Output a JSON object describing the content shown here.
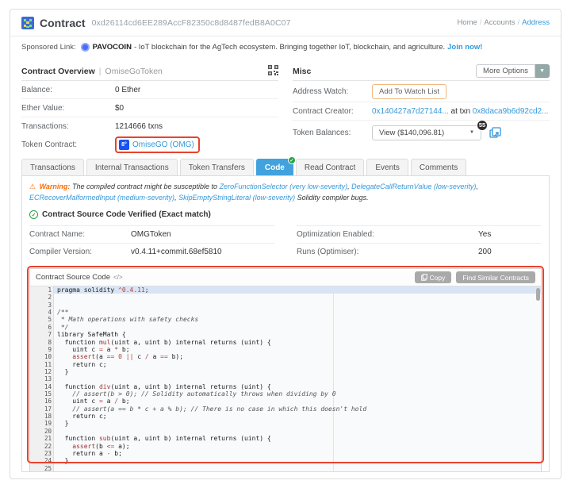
{
  "colors": {
    "accent_blue": "#3498db",
    "tab_active_blue": "#41a2dd",
    "annotation_red": "#e8432d",
    "warning_orange": "#ff6a00",
    "verified_green": "#2f9e44",
    "badge_green": "#28a745"
  },
  "header": {
    "title": "Contract",
    "address": "0xd26114cd6EE289AccF82350c8d8487fedB8A0C07",
    "breadcrumb": {
      "home": "Home",
      "accounts": "Accounts",
      "address": "Address",
      "separator": "/"
    }
  },
  "sponsored": {
    "label": "Sponsored Link:",
    "name": "PAVOCOIN",
    "text": "- IoT blockchain for the AgTech ecosystem. Bringing together IoT, blockchain, and agriculture.",
    "cta": "Join now!"
  },
  "overview": {
    "title": "Contract Overview",
    "divider": "|",
    "subtitle": "OmiseGoToken",
    "rows": [
      {
        "label": "Balance:",
        "value": "0 Ether"
      },
      {
        "label": "Ether Value:",
        "value": "$0"
      },
      {
        "label": "Transactions:",
        "value": "1214666 txns"
      }
    ],
    "token_label": "Token Contract:",
    "token_symbol": "8°",
    "token_link": "OmiseGO (OMG)"
  },
  "misc": {
    "title": "Misc",
    "more_options_label": "More Options",
    "more_options_caret": "▼",
    "address_watch_label": "Address Watch:",
    "watch_button_label": "Add To Watch List",
    "creator_label": "Contract Creator:",
    "creator_address": "0x140427a7d27144...",
    "creator_mid": "at txn",
    "creator_txn": "0x8daca9b6d92cd2...",
    "balances_label": "Token Balances:",
    "balances_value": "View ($140,096.81)",
    "balances_caret": "▼",
    "balances_badge": "55"
  },
  "tabs": [
    {
      "label": "Transactions",
      "active": false
    },
    {
      "label": "Internal Transactions",
      "active": false
    },
    {
      "label": "Token Transfers",
      "active": false
    },
    {
      "label": "Code",
      "active": true,
      "badge": "✓"
    },
    {
      "label": "Read Contract",
      "active": false
    },
    {
      "label": "Events",
      "active": false
    },
    {
      "label": "Comments",
      "active": false
    }
  ],
  "warning": {
    "triangle": "⚠",
    "prefix": "Warning:",
    "segments": [
      {
        "t": "The compiled contract might be susceptible to "
      },
      {
        "t": "ZeroFunctionSelector (very low-severity)",
        "link": true
      },
      {
        "t": ", "
      },
      {
        "t": "DelegateCallReturnValue (low-severity)",
        "link": true
      },
      {
        "t": ", "
      },
      {
        "t": "ECRecoverMalformedInput (medium-severity)",
        "link": true
      },
      {
        "t": ", "
      },
      {
        "t": "SkipEmptyStringLiteral (low-severity)",
        "link": true
      },
      {
        "t": " Solidity compiler bugs."
      }
    ]
  },
  "verified": {
    "check": "✓",
    "text": "Contract Source Code Verified (Exact match)"
  },
  "details": {
    "cells": [
      {
        "label": "Contract Name:",
        "value": "OMGToken",
        "side": "left"
      },
      {
        "label": "Optimization Enabled:",
        "value": "Yes",
        "side": "right"
      },
      {
        "label": "Compiler Version:",
        "value": "v0.4.11+commit.68ef5810",
        "side": "left"
      },
      {
        "label": "Runs (Optimiser):",
        "value": "200",
        "side": "right"
      }
    ]
  },
  "source": {
    "title": "Contract Source Code",
    "title_glyph": "</>",
    "copy_label": "Copy",
    "find_label": "Find Similar Contracts",
    "active_line": 1,
    "fold_lines": [
      4,
      7,
      8,
      14,
      21
    ],
    "lines": [
      [
        [
          "p",
          "pragma solidity "
        ],
        [
          "n",
          "^0.4.11"
        ],
        [
          "p",
          ";"
        ]
      ],
      [],
      [],
      [
        [
          "c",
          "/**"
        ]
      ],
      [
        [
          "c",
          " * Math operations with safety checks"
        ]
      ],
      [
        [
          "c",
          " */"
        ]
      ],
      [
        [
          "p",
          "library SafeMath {"
        ]
      ],
      [
        [
          "p",
          "  function "
        ],
        [
          "f",
          "mul"
        ],
        [
          "p",
          "(uint a, uint b) internal returns (uint) {"
        ]
      ],
      [
        [
          "p",
          "    uint c "
        ],
        [
          "o",
          "="
        ],
        [
          "p",
          " a "
        ],
        [
          "o",
          "*"
        ],
        [
          "p",
          " b;"
        ]
      ],
      [
        [
          "p",
          "    "
        ],
        [
          "f",
          "assert"
        ],
        [
          "p",
          "(a "
        ],
        [
          "o",
          "=="
        ],
        [
          "p",
          " "
        ],
        [
          "n",
          "0"
        ],
        [
          "p",
          " "
        ],
        [
          "o",
          "||"
        ],
        [
          "p",
          " c "
        ],
        [
          "o",
          "/"
        ],
        [
          "p",
          " a "
        ],
        [
          "o",
          "=="
        ],
        [
          "p",
          " b);"
        ]
      ],
      [
        [
          "p",
          "    return c;"
        ]
      ],
      [
        [
          "p",
          "  }"
        ]
      ],
      [],
      [
        [
          "p",
          "  function "
        ],
        [
          "f",
          "div"
        ],
        [
          "p",
          "(uint a, uint b) internal returns (uint) {"
        ]
      ],
      [
        [
          "c",
          "    // assert(b > 0); // Solidity automatically throws when dividing by 0"
        ]
      ],
      [
        [
          "p",
          "    uint c "
        ],
        [
          "o",
          "="
        ],
        [
          "p",
          " a "
        ],
        [
          "o",
          "/"
        ],
        [
          "p",
          " b;"
        ]
      ],
      [
        [
          "c",
          "    // assert(a == b * c + a % b); // There is no case in which this doesn't hold"
        ]
      ],
      [
        [
          "p",
          "    return c;"
        ]
      ],
      [
        [
          "p",
          "  }"
        ]
      ],
      [],
      [
        [
          "p",
          "  function "
        ],
        [
          "f",
          "sub"
        ],
        [
          "p",
          "(uint a, uint b) internal returns (uint) {"
        ]
      ],
      [
        [
          "p",
          "    "
        ],
        [
          "f",
          "assert"
        ],
        [
          "p",
          "(b "
        ],
        [
          "o",
          "<="
        ],
        [
          "p",
          " a);"
        ]
      ],
      [
        [
          "p",
          "    return a "
        ],
        [
          "o",
          "-"
        ],
        [
          "p",
          " b;"
        ]
      ],
      [
        [
          "p",
          "  }"
        ]
      ],
      []
    ]
  }
}
